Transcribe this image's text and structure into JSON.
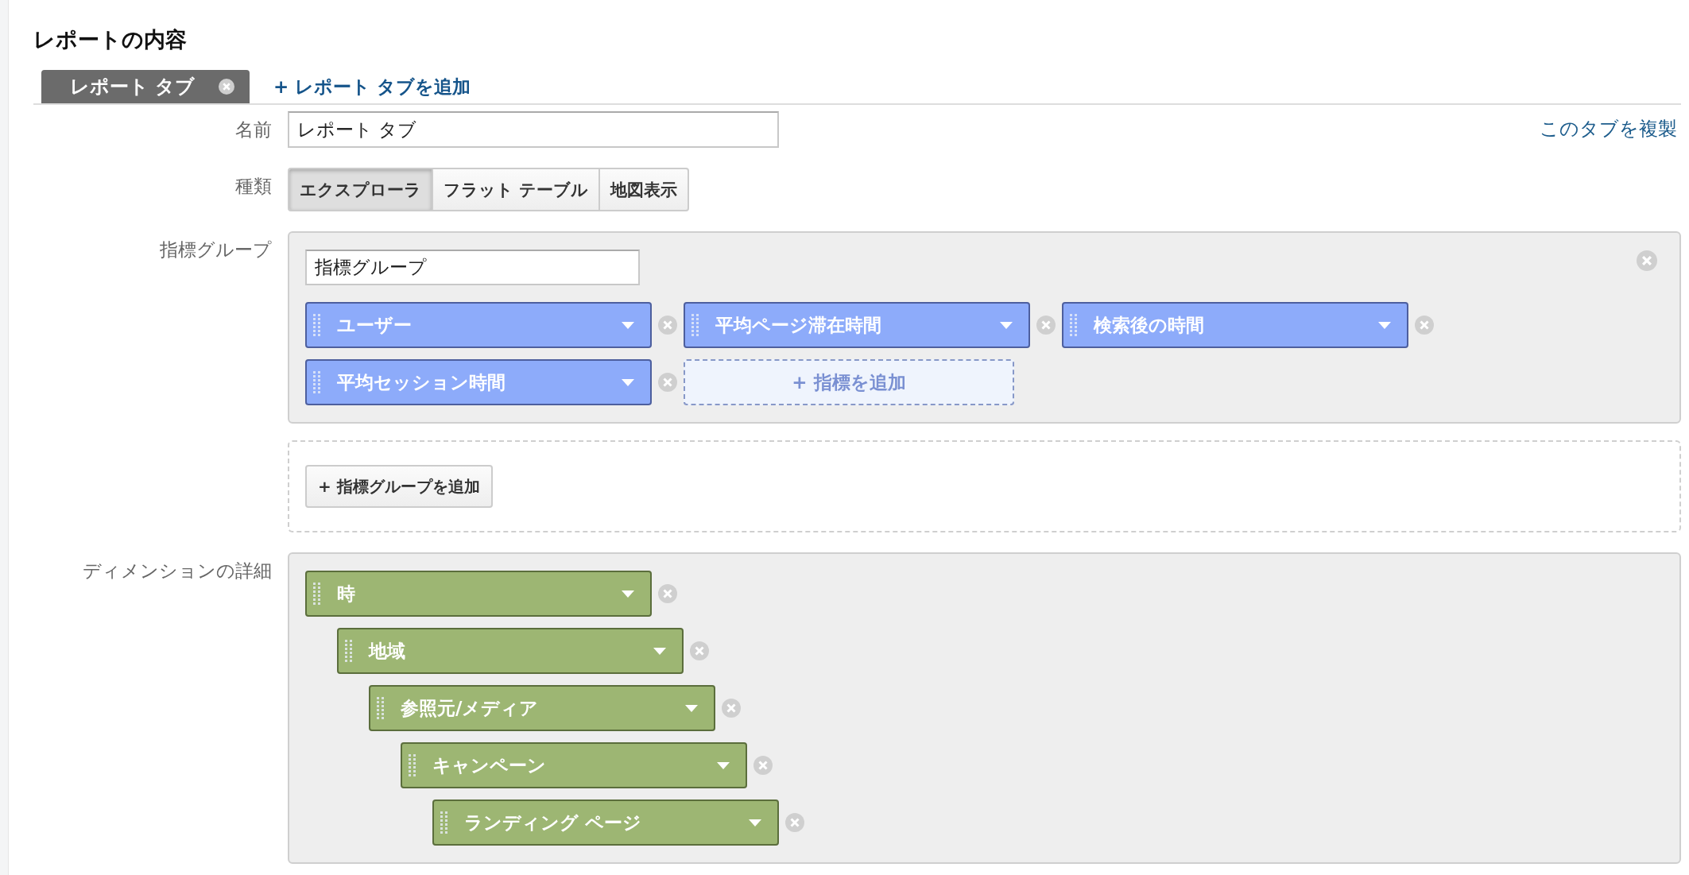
{
  "heading": "レポートの内容",
  "tabs": [
    {
      "label": "レポート タブ",
      "selected": true
    }
  ],
  "add_tab": "+ レポート タブを追加",
  "name_field": {
    "label": "名前",
    "value": "レポート タブ"
  },
  "duplicate_link": "このタブを複製",
  "type": {
    "label": "種類",
    "options": [
      {
        "label": "エクスプローラ",
        "selected": true
      },
      {
        "label": "フラット テーブル",
        "selected": false
      },
      {
        "label": "地図表示",
        "selected": false
      }
    ]
  },
  "metric_groups": {
    "label": "指標グループ",
    "groups": [
      {
        "name": "指標グループ",
        "metrics": [
          {
            "name": "ユーザー"
          },
          {
            "name": "平均ページ滞在時間"
          },
          {
            "name": "検索後の時間"
          },
          {
            "name": "平均セッション時間"
          }
        ],
        "add_metric": "+ 指標を追加"
      }
    ],
    "add_group": "+ 指標グループを追加"
  },
  "dimensions": {
    "label": "ディメンションの詳細",
    "items": [
      {
        "name": "時",
        "children": [
          {
            "name": "地域",
            "children": [
              {
                "name": "参照元/メディア",
                "children": [
                  {
                    "name": "キャンペーン",
                    "children": [
                      {
                        "name": "ランディング ページ"
                      }
                    ]
                  }
                ]
              }
            ]
          }
        ]
      }
    ]
  }
}
